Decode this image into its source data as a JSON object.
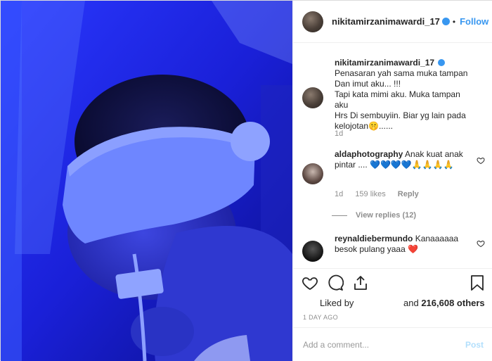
{
  "post": {
    "username": "nikitamirzanimawardi_17",
    "follow_dot": "•",
    "follow_label": "Follow",
    "caption": {
      "line1": "Penasaran yah sama muka tampan",
      "line2": "Dan imut aku... !!!",
      "line3": "Tapi kata mimi aku. Muka tampan aku",
      "line4": "Hrs Di sembuyiin. Biar yg lain pada",
      "line5": "kelojotan🤫......",
      "age": "1d"
    },
    "comments": [
      {
        "username": "aldaphotography",
        "text": "Anak kuat anak pintar .... 💙💙💙💙🙏🙏🙏🙏",
        "age": "1d",
        "likes": "159 likes",
        "reply_label": "Reply",
        "view_replies": "View replies (12)"
      },
      {
        "username": "reynaldiebermundo",
        "text": "Kanaaaaaa besok pulang yaaa ❤️"
      }
    ],
    "liked_by_label": "Liked by",
    "likes_and": "and",
    "likes_count": "216,608 others",
    "timestamp": "1 DAY AGO",
    "comment_placeholder": "Add a comment...",
    "post_button": "Post"
  },
  "colors": {
    "accent": "#3897f0",
    "post_disabled": "#b2dffc",
    "heart_red": "#ed4956",
    "photo_blue": "#1c1fd6"
  },
  "icons": [
    "verified-badge-icon",
    "heart-icon",
    "comment-icon",
    "share-icon",
    "bookmark-icon"
  ]
}
